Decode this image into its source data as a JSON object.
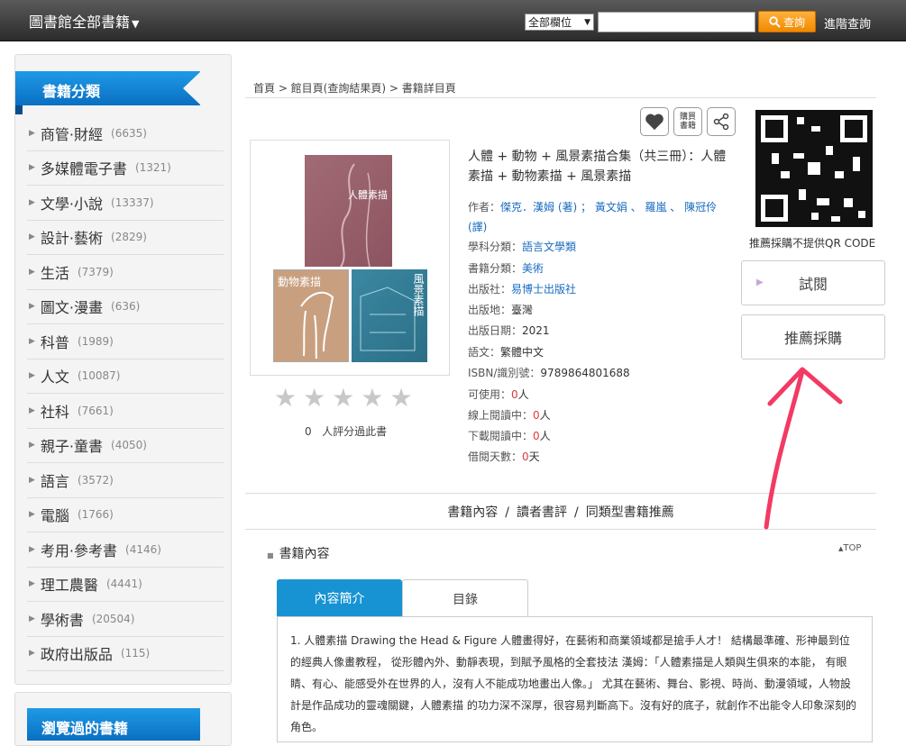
{
  "header": {
    "title": "圖書館全部書籍",
    "field_select": "全部欄位",
    "search_placeholder": "",
    "search_button": "查詢",
    "advanced_link": "進階查詢"
  },
  "sidebar": {
    "title": "書籍分類",
    "categories": [
      {
        "label": "商管·財經",
        "count": "(6635)"
      },
      {
        "label": "多媒體電子書",
        "count": "(1321)"
      },
      {
        "label": "文學·小說",
        "count": "(13337)"
      },
      {
        "label": "設計·藝術",
        "count": "(2829)"
      },
      {
        "label": "生活",
        "count": "(7379)"
      },
      {
        "label": "圖文·漫畫",
        "count": "(636)"
      },
      {
        "label": "科普",
        "count": "(1989)"
      },
      {
        "label": "人文",
        "count": "(10087)"
      },
      {
        "label": "社科",
        "count": "(7661)"
      },
      {
        "label": "親子·童書",
        "count": "(4050)"
      },
      {
        "label": "語言",
        "count": "(3572)"
      },
      {
        "label": "電腦",
        "count": "(1766)"
      },
      {
        "label": "考用·參考書",
        "count": "(4146)"
      },
      {
        "label": "理工農醫",
        "count": "(4441)"
      },
      {
        "label": "學術書",
        "count": "(20504)"
      },
      {
        "label": "政府出版品",
        "count": "(115)"
      }
    ],
    "browsed_title": "瀏覽過的書籍"
  },
  "breadcrumb": "首頁 > 館目頁(查詢結果頁) > 書籍詳目頁",
  "actions": {
    "buy_label_1": "購買",
    "buy_label_2": "書籍"
  },
  "book": {
    "title": "人體 + 動物 + 風景素描合集（共三冊）：人體素描 + 動物素描 + 風景素描",
    "author_label": "作者：",
    "author_value": "傑克．漢姆 (著) ； 黃文娟 、 羅嵐 、 陳冠伶 (譯)",
    "subject_label": "學科分類：",
    "subject_value": "語言文學類",
    "category_label": "書籍分類：",
    "category_value": "美術",
    "publisher_label": "出版社：",
    "publisher_value": "易博士出版社",
    "place_label": "出版地：",
    "place_value": "臺灣",
    "date_label": "出版日期：",
    "date_value": "2021",
    "lang_label": "語文：",
    "lang_value": "繁體中文",
    "isbn_label": "ISBN/識別號：",
    "isbn_value": "9789864801688",
    "avail_label": "可使用：",
    "avail_value": "0",
    "avail_unit": "人",
    "online_label": "線上閱讀中：",
    "online_value": "0",
    "online_unit": "人",
    "download_label": "下載閱讀中：",
    "download_value": "0",
    "download_unit": "人",
    "loan_label": "借閱天數：",
    "loan_value": "0",
    "loan_unit": "天"
  },
  "covers": {
    "top": "人體素描",
    "left": "動物素描",
    "right": "風景素描"
  },
  "rating": {
    "count": "0",
    "text": "人評分過此書",
    "stars": 0
  },
  "qr_note": "推薦採購不提供QR CODE",
  "side_buttons": {
    "trial": "試閱",
    "recommend": "推薦採購"
  },
  "sections": {
    "content": "書籍內容",
    "review": "讀者書評",
    "similar": "同類型書籍推薦",
    "sep": "/",
    "content_heading": "書籍內容",
    "top": "TOP"
  },
  "tabs": {
    "intro": "內容簡介",
    "toc": "目錄"
  },
  "intro_text": "1. 人體素描 Drawing the Head & Figure 人體畫得好，在藝術和商業領域都是搶手人才！ 結構最準確、形神最到位的經典人像畫教程， 從形體內外、動靜表現，到賦予風格的全套技法 漢姆：「人體素描是人類與生俱來的本能， 有眼睛、有心、能感受外在世界的人，沒有人不能成功地畫出人像。」 尤其在藝術、舞台、影視、時尚、動漫領域，人物設計是作品成功的靈魂關鍵，人體素描 的功力深不深厚，很容易判斷高下。沒有好的底子，就創作不出能令人印象深刻的角色。"
}
